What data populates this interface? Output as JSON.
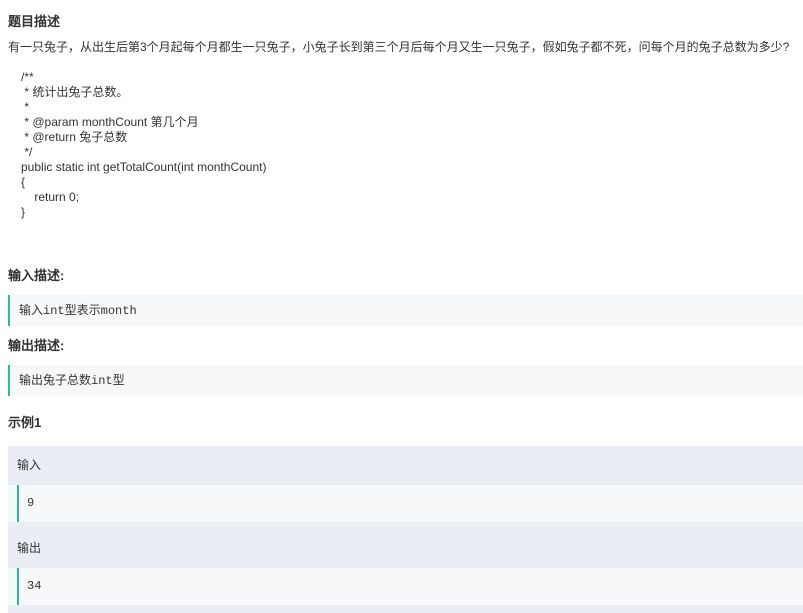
{
  "problem": {
    "title": "题目描述",
    "description": "有一只兔子，从出生后第3个月起每个月都生一只兔子，小兔子长到第三个月后每个月又生一只兔子，假如兔子都不死，问每个月的兔子总数为多少?",
    "code_lines": [
      "/**",
      " * 统计出兔子总数。",
      " *",
      " * @param monthCount 第几个月",
      " * @return 兔子总数",
      " */",
      "public static int getTotalCount(int monthCount)",
      "{",
      "    return 0;",
      "}"
    ]
  },
  "input_section": {
    "title": "输入描述:",
    "text_prefix": "输入",
    "text_code": "int",
    "text_middle": "型表示",
    "text_code2": "month"
  },
  "output_section": {
    "title": "输出描述:",
    "text_prefix": "输出兔子总数",
    "text_code": "int",
    "text_suffix": "型"
  },
  "example": {
    "title": "示例1",
    "input_label": "输入",
    "input_value": "9",
    "output_label": "输出",
    "output_value": "34"
  },
  "colors": {
    "accent": "#25bb9b",
    "quote_bg": "#f7f8fa",
    "example_bg": "#eaeef4",
    "text": "#333333"
  }
}
